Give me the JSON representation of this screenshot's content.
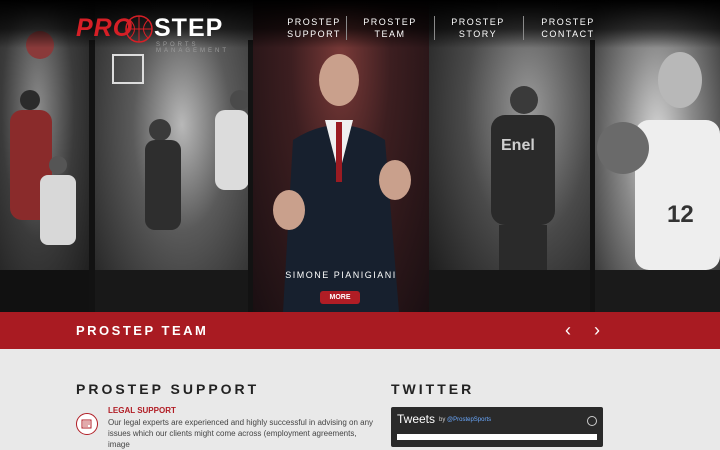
{
  "brand": {
    "logo_primary": "PRO",
    "logo_secondary": "STEP",
    "logo_tagline": "SPORTS MANAGEMENT",
    "accent_color": "#d61f26"
  },
  "nav": {
    "items": [
      {
        "line1": "PROSTEP",
        "line2": "SUPPORT"
      },
      {
        "line1": "PROSTEP",
        "line2": "TEAM"
      },
      {
        "line1": "PROSTEP",
        "line2": "STORY"
      },
      {
        "line1": "PROSTEP",
        "line2": "CONTACT"
      }
    ]
  },
  "hero": {
    "featured_name": "SIMONE PIANIGIANI",
    "more_label": "MORE"
  },
  "team_band": {
    "title": "PROSTEP TEAM",
    "prev_icon": "chevron-left-icon",
    "next_icon": "chevron-right-icon"
  },
  "support": {
    "title": "PROSTEP SUPPORT",
    "legal_title": "LEGAL SUPPORT",
    "legal_text": "Our legal experts are experienced and highly successful in advising on any issues which our clients might come across (employment agreements, image"
  },
  "twitter": {
    "title": "TWITTER",
    "widget_title": "Tweets",
    "by_prefix": "by",
    "handle": "@ProstepSports"
  }
}
